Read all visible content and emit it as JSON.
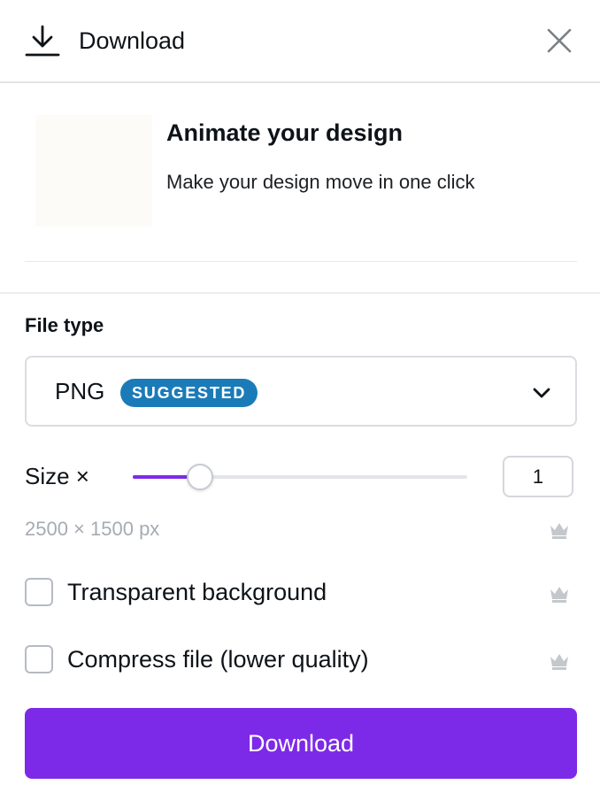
{
  "header": {
    "title": "Download",
    "icon": "download-icon",
    "close_icon": "close-icon"
  },
  "promo": {
    "title": "Animate your design",
    "subtitle": "Make your design move in one click"
  },
  "file_type": {
    "label": "File type",
    "selected": "PNG",
    "badge": "SUGGESTED",
    "badge_color": "#1b7bb8"
  },
  "size": {
    "label": "Size ×",
    "value": "1",
    "slider_fraction": 0.2,
    "dimensions": "2500 × 1500 px"
  },
  "options": [
    {
      "label": "Transparent background",
      "checked": false,
      "pro": true
    },
    {
      "label": "Compress file (lower quality)",
      "checked": false,
      "pro": true
    }
  ],
  "download_button": {
    "label": "Download"
  },
  "colors": {
    "accent": "#7d2ae8",
    "muted_text": "#a6abb2"
  }
}
